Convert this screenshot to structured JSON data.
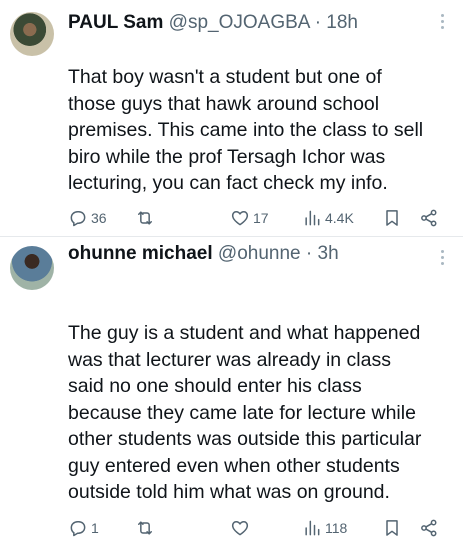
{
  "tweets": [
    {
      "display_name": "PAUL Sam",
      "handle": "@sp_OJOAGBA",
      "time": "18h",
      "text": "That boy wasn't a student but one of\nthose guys that hawk around school\npremises. This came into the class to sell\nbiro while the prof Tersagh Ichor was\nlecturing, you can fact check my info.",
      "replies": "36",
      "retweets": "",
      "likes": "17",
      "views": "4.4K"
    },
    {
      "display_name": "ohunne michael",
      "handle": "@ohunne",
      "time": "3h",
      "text": "The guy is a student and what happened\nwas that lecturer was already in class\nsaid no one should enter his class\nbecause they came late for lecture while\nother students was outside this particular\nguy entered even when other students\noutside told him what was on ground.",
      "replies": "1",
      "retweets": "",
      "likes": "",
      "views": "118"
    }
  ],
  "icons": {
    "reply": "reply-icon",
    "retweet": "retweet-icon",
    "like": "heart-icon",
    "views": "analytics-icon",
    "bookmark": "bookmark-icon",
    "share": "share-icon"
  },
  "colors": {
    "text": "#0f1419",
    "muted": "#536471",
    "divider": "#e6e9ec"
  }
}
